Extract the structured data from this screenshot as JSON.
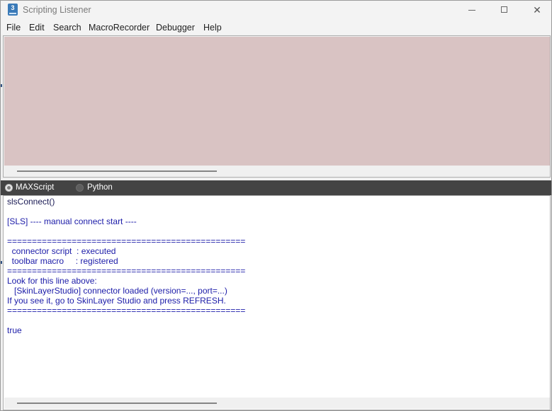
{
  "window": {
    "title": "Scripting Listener",
    "icon_label": "3",
    "icon": "app-3dsmax-icon",
    "controls": [
      "minimize-icon",
      "maximize-icon",
      "close-icon"
    ],
    "close_glyph": "✕"
  },
  "menu": {
    "items": [
      {
        "label": "File"
      },
      {
        "label": "Edit"
      },
      {
        "label": "Search"
      },
      {
        "label": "MacroRecorder"
      },
      {
        "label": "Debugger"
      },
      {
        "label": "Help"
      }
    ]
  },
  "macro_recorder": {
    "background_color": "#d9c3c3"
  },
  "language_bar": {
    "options": [
      {
        "label": "MAXScript",
        "selected": true
      },
      {
        "label": "Python",
        "selected": false
      }
    ]
  },
  "output": {
    "command_color": "#1b1b55",
    "output_color": "#1b1ba8",
    "lines": [
      {
        "text": "slsConnect()",
        "type": "cmd"
      },
      {
        "text": "",
        "type": "out"
      },
      {
        "text": "[SLS] ---- manual connect start ----",
        "type": "out"
      },
      {
        "text": "",
        "type": "out"
      },
      {
        "text": "================================================",
        "type": "out"
      },
      {
        "text": "  connector script  : executed",
        "type": "out"
      },
      {
        "text": "  toolbar macro     : registered",
        "type": "out"
      },
      {
        "text": "================================================",
        "type": "out"
      },
      {
        "text": "Look for this line above:",
        "type": "out"
      },
      {
        "text": "   [SkinLayerStudio] connector loaded (version=..., port=...)",
        "type": "out"
      },
      {
        "text": "If you see it, go to SkinLayer Studio and press REFRESH.",
        "type": "out"
      },
      {
        "text": "================================================",
        "type": "out"
      },
      {
        "text": "",
        "type": "out"
      },
      {
        "text": "true",
        "type": "out"
      }
    ]
  }
}
